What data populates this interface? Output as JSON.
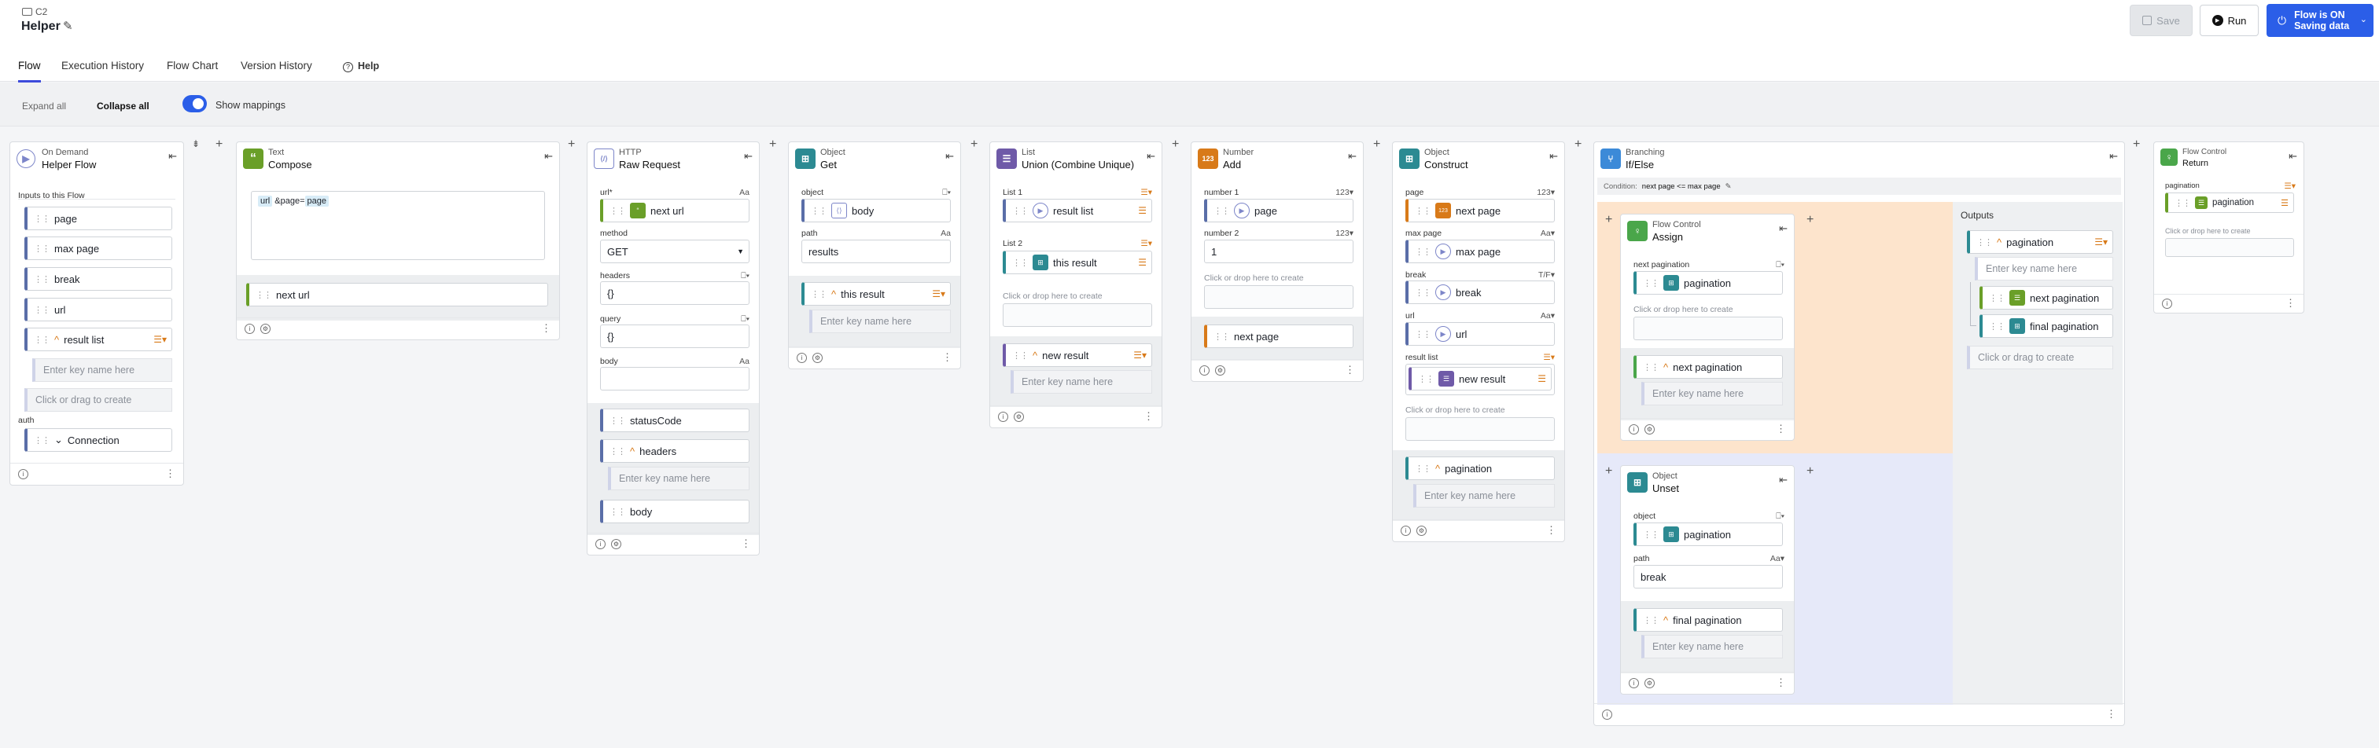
{
  "header": {
    "breadcrumb": "C2",
    "title": "Helper",
    "save_label": "Save",
    "run_label": "Run",
    "flow_status": "Flow is ON",
    "saving_status": "Saving data"
  },
  "tabs": [
    {
      "label": "Flow"
    },
    {
      "label": "Execution History"
    },
    {
      "label": "Flow Chart"
    },
    {
      "label": "Version History"
    },
    {
      "label": "Help"
    }
  ],
  "toolbar": {
    "expand_all": "Expand all",
    "collapse_all": "Collapse all",
    "show_mappings": "Show mappings"
  },
  "colors": {
    "accent": "#3d4bdb",
    "run_blue": "#2b5ee8",
    "ondemand": "#7d86c9",
    "text": "#6a9f28",
    "http": "#7d86c9",
    "object": "#2c8a92",
    "list": "#6f5aa8",
    "number": "#d87a19",
    "branch": "#3c8ad8",
    "flowctl": "#4aa64a",
    "assign_bg": "#fde4cc",
    "unset_bg": "#e6e9f9",
    "outputs_bg": "#eef0f2"
  },
  "cards": {
    "ondemand": {
      "type": "On Demand",
      "name": "Helper Flow",
      "inputs_label": "Inputs to this Flow",
      "inputs": [
        "page",
        "max page",
        "break",
        "url"
      ],
      "list_input": "result list",
      "key_placeholder": "Enter key name here",
      "create_hint": "Click or drag to create",
      "auth_label": "auth",
      "auth_value": "Connection"
    },
    "text": {
      "type": "Text",
      "name": "Compose",
      "tok1": "url",
      "amp": " &page=",
      "tok2": "page",
      "output": "next url"
    },
    "http": {
      "type": "HTTP",
      "name": "Raw Request",
      "url_label": "url*",
      "url_type": "Aa",
      "url_value": "next url",
      "method_label": "method",
      "method_value": "GET",
      "headers_label": "headers",
      "headers_value": "{}",
      "query_label": "query",
      "query_value": "{}",
      "body_label": "body",
      "body_type": "Aa",
      "out_status": "statusCode",
      "out_headers": "headers",
      "key_placeholder": "Enter key name here",
      "out_body": "body"
    },
    "get": {
      "type": "Object",
      "name": "Get",
      "object_label": "object",
      "object_value": "body",
      "path_label": "path",
      "path_type": "Aa",
      "path_value": "results",
      "output": "this result",
      "key_placeholder": "Enter key name here"
    },
    "union": {
      "type": "List",
      "name": "Union (Combine Unique)",
      "list1_label": "List 1",
      "list1_value": "result list",
      "list2_label": "List 2",
      "list2_value": "this result",
      "hint": "Click or drop here to create",
      "output": "new result",
      "key_placeholder": "Enter key name here"
    },
    "add": {
      "type": "Number",
      "name": "Add",
      "n1_label": "number 1",
      "n1_type": "123",
      "n1_value": "page",
      "n2_label": "number 2",
      "n2_type": "123",
      "n2_value": "1",
      "hint": "Click or drop here to create",
      "output": "next page"
    },
    "construct": {
      "type": "Object",
      "name": "Construct",
      "page_label": "page",
      "page_type": "123",
      "page_value": "next page",
      "maxpage_label": "max page",
      "maxpage_type": "Aa",
      "maxpage_value": "max page",
      "break_label": "break",
      "break_type": "T/F",
      "break_value": "break",
      "url_label": "url",
      "url_type": "Aa",
      "url_value": "url",
      "resultlist_label": "result list",
      "resultlist_value": "new result",
      "hint": "Click or drop here to create",
      "output": "pagination",
      "key_placeholder": "Enter key name here"
    },
    "branch": {
      "type": "Branching",
      "name": "If/Else",
      "condition_label": "Condition:",
      "condition_value": "next page <= max page",
      "outputs_label": "Outputs",
      "out_pagination": "pagination",
      "key_placeholder": "Enter key name here",
      "out_next": "next pagination",
      "out_final": "final pagination",
      "create_hint": "Click or drag to create"
    },
    "assign": {
      "type": "Flow Control",
      "name": "Assign",
      "field_label": "next pagination",
      "field_value": "pagination",
      "hint": "Click or drop here to create",
      "output": "next pagination",
      "key_placeholder": "Enter key name here"
    },
    "unset": {
      "type": "Object",
      "name": "Unset",
      "object_label": "object",
      "object_value": "pagination",
      "path_label": "path",
      "path_type": "Aa",
      "path_value": "break",
      "output": "final pagination",
      "key_placeholder": "Enter key name here"
    },
    "ret": {
      "type": "Flow Control",
      "name": "Return",
      "field_label": "pagination",
      "field_value": "pagination",
      "hint": "Click or drop here to create"
    }
  }
}
